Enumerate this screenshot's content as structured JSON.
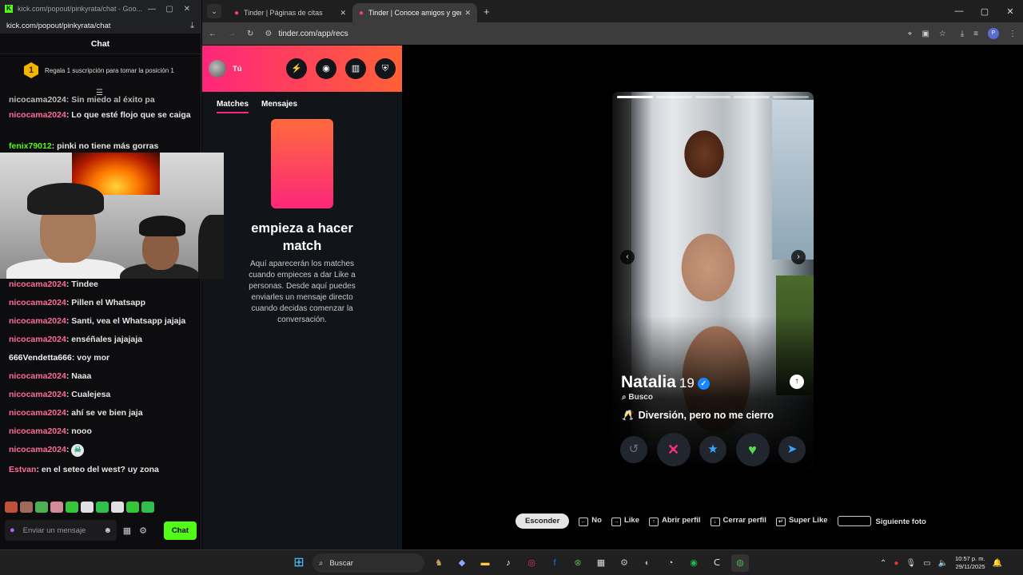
{
  "kick": {
    "tab_title": "kick.com/popout/pinkyrata/chat - Goo...",
    "url": "kick.com/popout/pinkyrata/chat",
    "chat_title": "Chat",
    "gift_rank": "1",
    "gift_text": "Regala 1 suscripción para tomar la posición 1",
    "cut_text": "nicocama2024: Sin miedo al éxito pa",
    "messages": [
      {
        "user": "nicocama2024",
        "text": "Lo que esté flojo que se caiga",
        "color": "#ff6b9a"
      },
      {
        "user": "fenix79012",
        "text": "pinki no tiene más gorras",
        "color": "#53fc18"
      },
      {
        "user": "nicocama2024",
        "text": "Tindee",
        "color": "#ff6b9a"
      },
      {
        "user": "nicocama2024",
        "text": "Pillen el Whatsapp",
        "color": "#ff6b9a"
      },
      {
        "user": "nicocama2024",
        "text": "Santi, vea el Whatsapp jajaja",
        "color": "#ff6b9a"
      },
      {
        "user": "nicocama2024",
        "text": "enséñales jajajaja",
        "color": "#ff6b9a"
      },
      {
        "user": "666Vendetta666",
        "text": "voy mor",
        "color": "#f2f2f2"
      },
      {
        "user": "nicocama2024",
        "text": "Naaa",
        "color": "#ff6b9a"
      },
      {
        "user": "nicocama2024",
        "text": "Cualejesa",
        "color": "#ff6b9a"
      },
      {
        "user": "nicocama2024",
        "text": "ahí se ve bien jaja",
        "color": "#ff6b9a"
      },
      {
        "user": "nicocama2024",
        "text": "nooo",
        "color": "#ff6b9a"
      },
      {
        "user": "nicocama2024",
        "text": "☠",
        "color": "#ff6b9a"
      },
      {
        "user": "Estvan",
        "text": "en el seteo del west? uy zona",
        "color": "#ff6b9a"
      }
    ],
    "input_placeholder": "Enviar un mensaje",
    "send_label": "Chat"
  },
  "chrome": {
    "tabs": [
      {
        "title": "Tinder | Páginas de citas"
      },
      {
        "title": "Tinder | Conoce amigos y gente nueva"
      }
    ],
    "url": "tinder.com/app/recs"
  },
  "tinder": {
    "user_label": "Tú",
    "tab_matches": "Matches",
    "tab_messages": "Mensajes",
    "empty_title": "empieza a hacer match",
    "empty_desc": "Aquí aparecerán los matches cuando empieces a dar Like a personas. Desde aquí puedes enviarles un mensaje directo cuando decidas comenzar la conversación.",
    "profile": {
      "name": "Natalia",
      "age": "19",
      "looking_label": "Busco",
      "looking_value": "Diversión, pero no me cierro",
      "looking_emoji": "🥂"
    },
    "hints": {
      "hide": "Esconder",
      "no": "No",
      "like": "Like",
      "open": "Abrir perfil",
      "close": "Cerrar perfil",
      "superlike": "Super Like",
      "next_photo": "Siguiente foto"
    }
  },
  "taskbar": {
    "search": "Buscar",
    "time": "10:57 p. m.",
    "date": "29/11/2025"
  },
  "colors": {
    "kick_green": "#53fc18",
    "tinder_pink": "#fd267a",
    "tinder_orange": "#ff6036"
  }
}
